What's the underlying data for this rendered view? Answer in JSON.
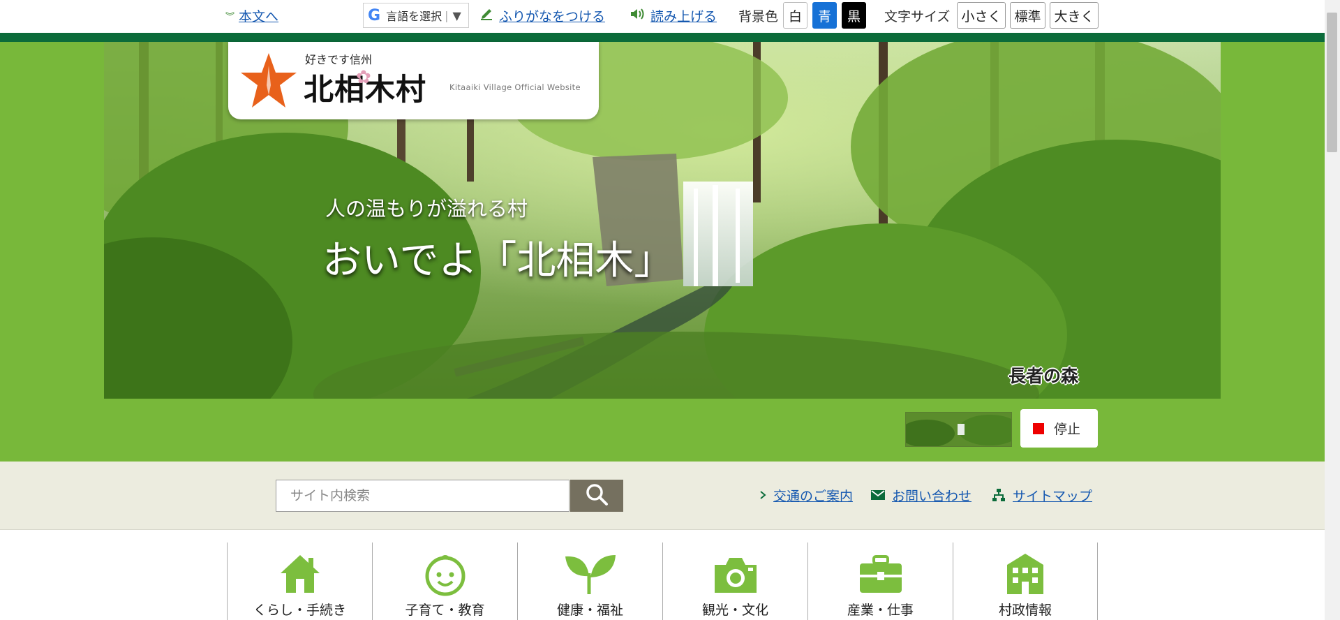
{
  "utility": {
    "skip_link": "本文へ",
    "language_select": "言語を選択",
    "language_arrow": "▼",
    "furigana": "ふりがなをつける",
    "read_aloud": "読み上げる",
    "bg_color_label": "背景色",
    "bg_white": "白",
    "bg_blue": "青",
    "bg_black": "黒",
    "font_size_label": "文字サイズ",
    "font_small": "小さく",
    "font_standard": "標準",
    "font_large": "大きく"
  },
  "logo": {
    "tagline": "好きです信州",
    "name": "北相木村",
    "english": "Kitaaiki Village Official Website"
  },
  "hero": {
    "catch_small": "人の温もりが溢れる村",
    "catch_big": "おいでよ「北相木」",
    "photo_caption": "長者の森",
    "stop_label": "停止"
  },
  "search": {
    "placeholder": "サイト内検索"
  },
  "links": {
    "access": "交通のご案内",
    "contact": "お問い合わせ",
    "sitemap": "サイトマップ"
  },
  "categories": [
    {
      "label": "くらし・手続き",
      "icon": "house-icon"
    },
    {
      "label": "子育て・教育",
      "icon": "baby-face-icon"
    },
    {
      "label": "健康・福祉",
      "icon": "sprout-icon"
    },
    {
      "label": "観光・文化",
      "icon": "camera-icon"
    },
    {
      "label": "産業・仕事",
      "icon": "briefcase-icon"
    },
    {
      "label": "村政情報",
      "icon": "building-icon"
    }
  ],
  "colors": {
    "brand_green": "#78b83a",
    "dark_green": "#0b6b3a",
    "accent_icon_green": "#7cbe3e",
    "link_blue": "#1558b0"
  }
}
